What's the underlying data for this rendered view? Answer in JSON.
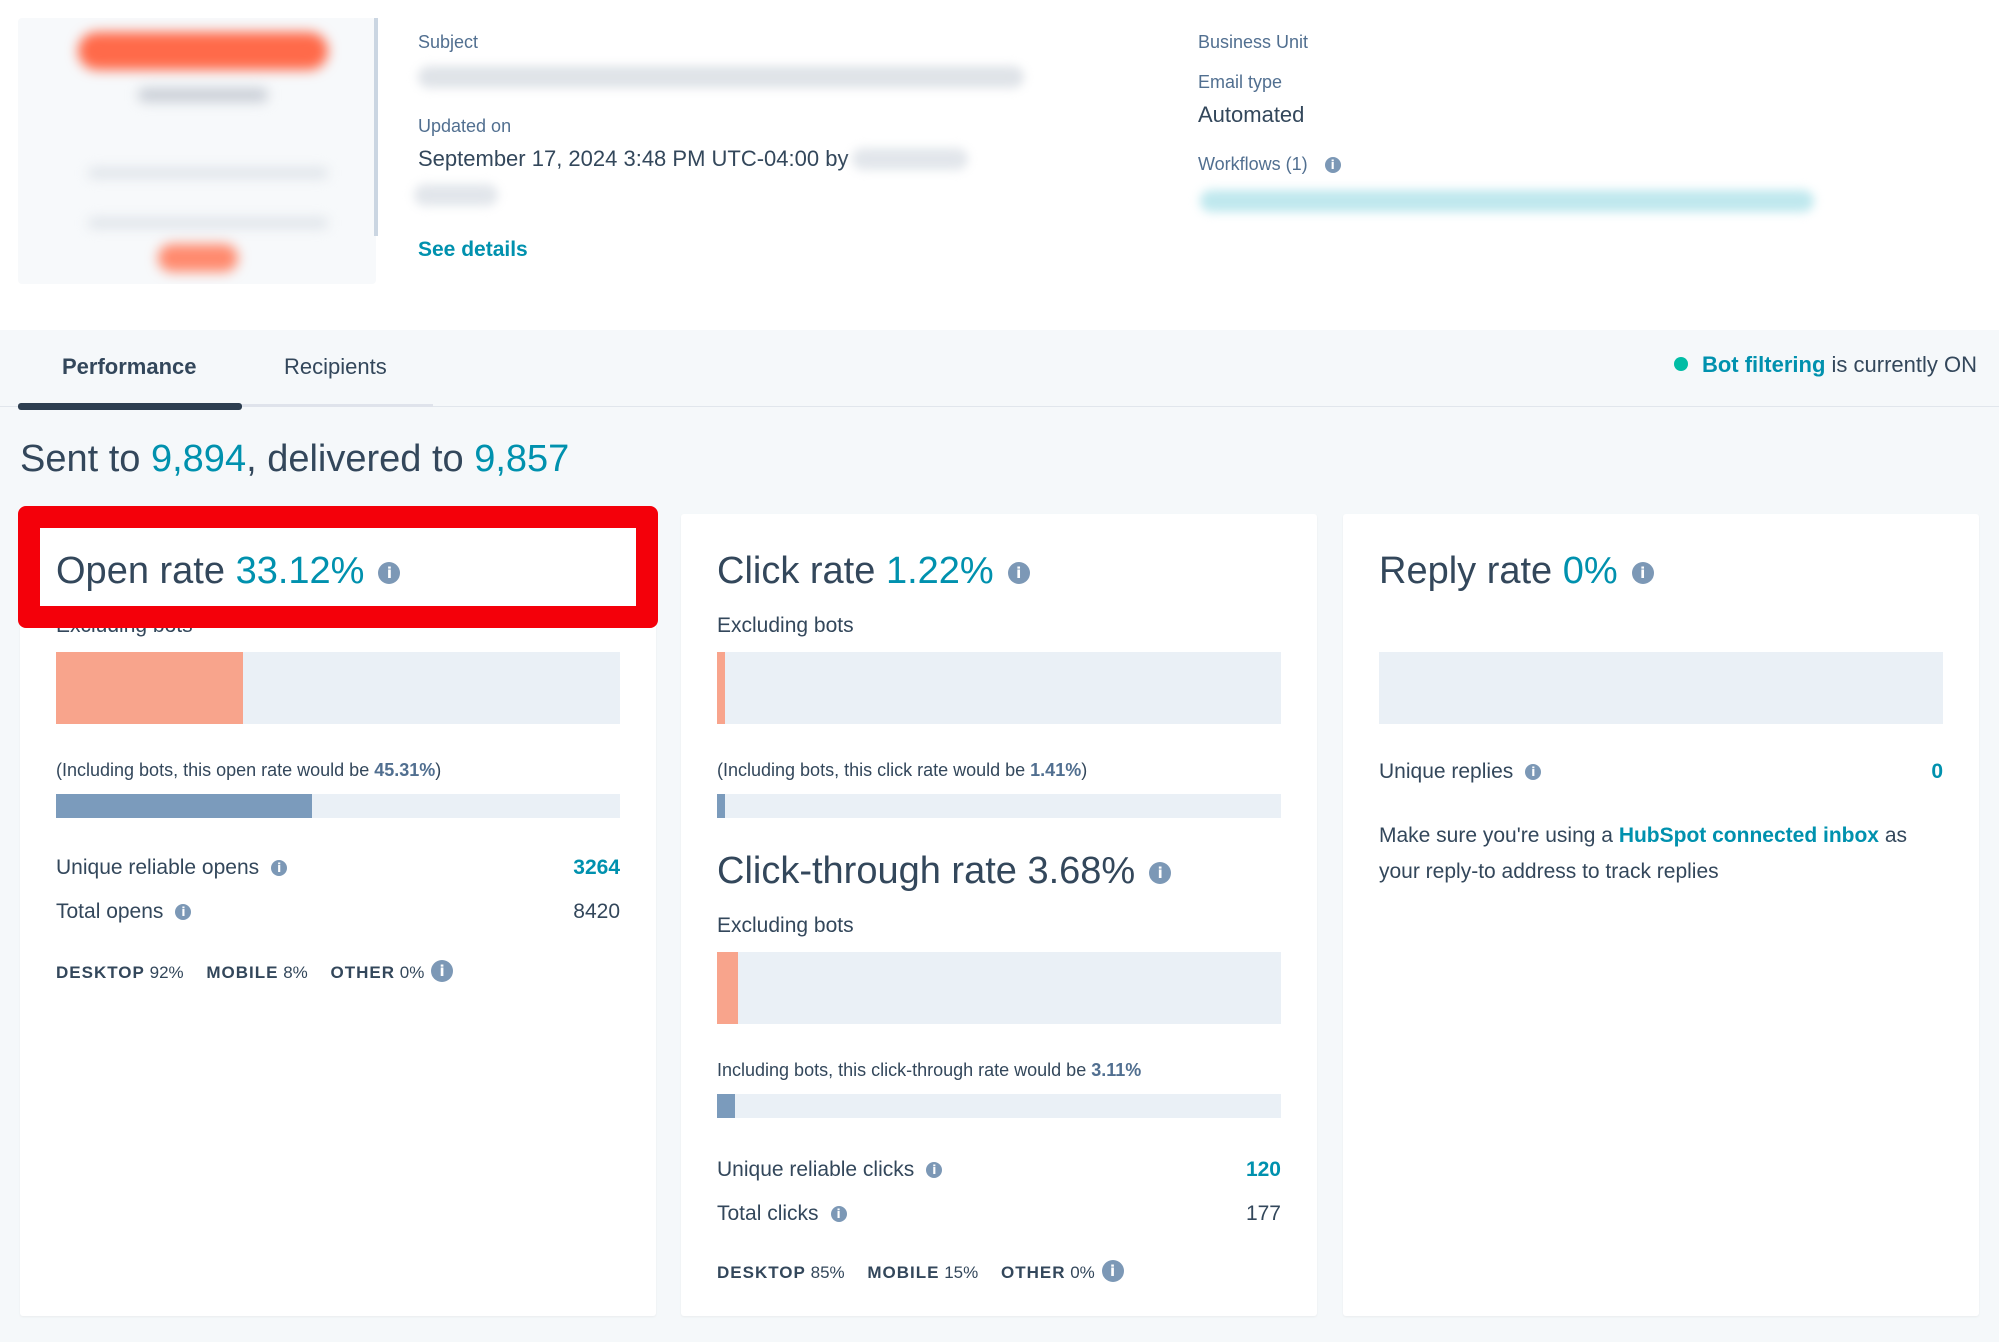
{
  "header": {
    "subject_label": "Subject",
    "updated_label": "Updated on",
    "updated_value": "September 17, 2024 3:48 PM UTC-04:00 by",
    "see_details": "See details",
    "business_unit_label": "Business Unit",
    "email_type_label": "Email type",
    "email_type_value": "Automated",
    "workflows_label": "Workflows (1)"
  },
  "tabs": [
    {
      "label": "Performance",
      "active": true
    },
    {
      "label": "Recipients",
      "active": false
    }
  ],
  "bot_filtering": {
    "link": "Bot filtering",
    "text": "is currently ON"
  },
  "summary": {
    "sent_prefix": "Sent to",
    "sent": "9,894",
    "delivered_prefix": ", delivered to",
    "delivered": "9,857"
  },
  "open_card": {
    "title": "Open rate",
    "value": "33.12%",
    "excluding": "Excluding bots",
    "bar_fraction": 0.3312,
    "note_prefix": "(Including bots, this open rate would be",
    "note_value": "45.31%",
    "note_suffix": ")",
    "incl_fraction": 0.4531,
    "unique_label": "Unique reliable opens",
    "unique_value": "3264",
    "total_label": "Total opens",
    "total_value": "8420",
    "devices": [
      {
        "key": "DESKTOP",
        "value": "92%"
      },
      {
        "key": "MOBILE",
        "value": "8%"
      },
      {
        "key": "OTHER",
        "value": "0%"
      }
    ]
  },
  "click_card": {
    "title": "Click rate",
    "value": "1.22%",
    "excluding": "Excluding bots",
    "bar_fraction": 0.0122,
    "note_prefix": "(Including bots, this click rate would be",
    "note_value": "1.41%",
    "note_suffix": ")",
    "incl_fraction": 0.0141,
    "ctr_title": "Click-through rate 3.68%",
    "ctr_excluding": "Excluding bots",
    "ctr_fraction": 0.0368,
    "ctr_note_prefix": "Including bots, this click-through rate would be",
    "ctr_note_value": "3.11%",
    "ctr_incl_fraction": 0.0311,
    "unique_label": "Unique reliable clicks",
    "unique_value": "120",
    "total_label": "Total clicks",
    "total_value": "177",
    "devices": [
      {
        "key": "DESKTOP",
        "value": "85%"
      },
      {
        "key": "MOBILE",
        "value": "15%"
      },
      {
        "key": "OTHER",
        "value": "0%"
      }
    ]
  },
  "reply_card": {
    "title": "Reply rate",
    "value": "0%",
    "bar_fraction": 0,
    "unique_label": "Unique replies",
    "unique_value": "0",
    "msg_prefix": "Make sure you're using a",
    "msg_link": "HubSpot connected inbox",
    "msg_suffix": "as",
    "msg_line2": "your reply-to address to track replies"
  },
  "colors": {
    "accent": "#0091ae",
    "bar_excluding": "#f8a48c",
    "bar_including": "#7b9bbc",
    "highlight": "#f4000a",
    "bot_dot": "#00bda5"
  }
}
